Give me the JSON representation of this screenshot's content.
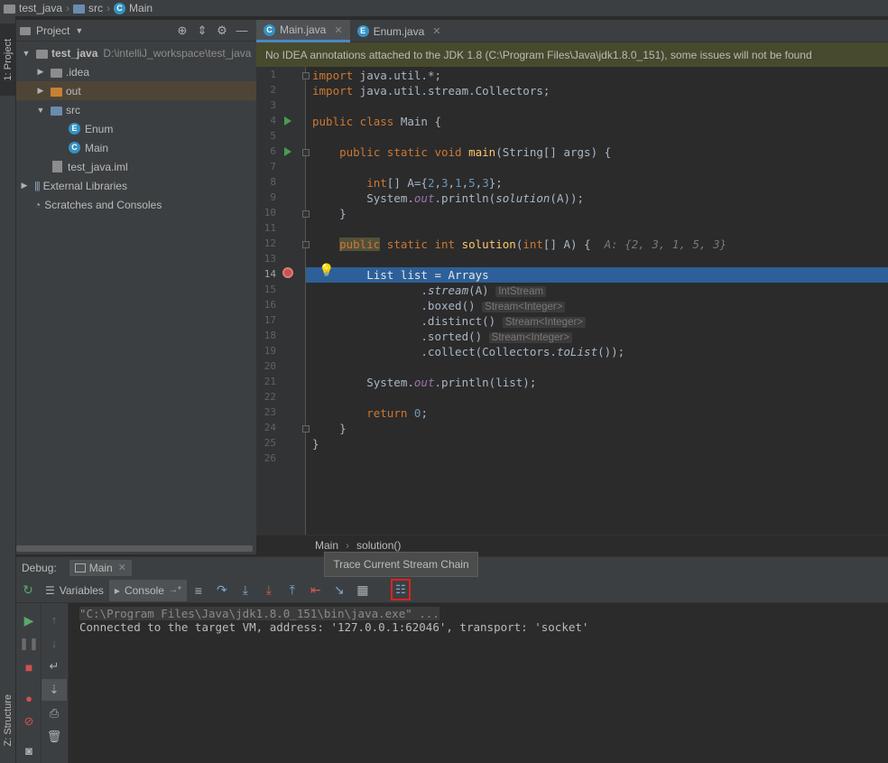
{
  "breadcrumb": {
    "project": "test_java",
    "folder": "src",
    "file": "Main"
  },
  "side_tabs": {
    "project": "1: Project",
    "structure": "Z: Structure"
  },
  "project_panel": {
    "header": "Project",
    "tree": [
      {
        "label": "test_java",
        "path": "D:\\intelliJ_workspace\\test_java"
      },
      {
        "label": ".idea"
      },
      {
        "label": "out"
      },
      {
        "label": "src"
      },
      {
        "label": "Enum"
      },
      {
        "label": "Main"
      },
      {
        "label": "test_java.iml"
      },
      {
        "label": "External Libraries"
      },
      {
        "label": "Scratches and Consoles"
      }
    ]
  },
  "editor": {
    "tabs": [
      {
        "label": "Main.java",
        "active": true
      },
      {
        "label": "Enum.java",
        "active": false
      }
    ],
    "banner": "No IDEA annotations attached to the JDK 1.8 (C:\\Program Files\\Java\\jdk1.8.0_151), some issues will not be found",
    "line_numbers": [
      "1",
      "2",
      "3",
      "4",
      "5",
      "6",
      "7",
      "8",
      "9",
      "10",
      "11",
      "12",
      "13",
      "14",
      "15",
      "16",
      "17",
      "18",
      "19",
      "20",
      "21",
      "22",
      "23",
      "24",
      "25",
      "26"
    ],
    "current_line": "14",
    "hints": {
      "A_value": "A: {2, 3, 1, 5, 3}",
      "stream": "IntStream",
      "boxed": "Stream<Integer>",
      "distinct": "Stream<Integer>",
      "sorted": "Stream<Integer>"
    },
    "footer_crumbs": [
      "Main",
      "solution()"
    ]
  },
  "debug": {
    "label": "Debug:",
    "session": "Main",
    "tabs": {
      "variables": "Variables",
      "console": "Console"
    },
    "tooltip": "Trace Current Stream Chain",
    "console_lines": [
      "\"C:\\Program Files\\Java\\jdk1.8.0_151\\bin\\java.exe\" ...",
      "Connected to the target VM, address: '127.0.0.1:62046', transport: 'socket'"
    ]
  }
}
